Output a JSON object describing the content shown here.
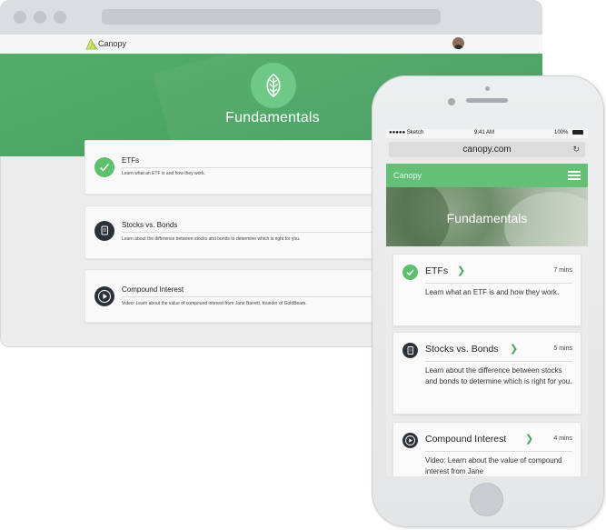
{
  "desktop": {
    "brand": "Canopy",
    "hero_title": "Fundamentals",
    "lessons": [
      {
        "title": "ETFs",
        "desc": "Learn what an ETF is and how they work.",
        "icon": "check-icon"
      },
      {
        "title": "Stocks vs. Bonds",
        "desc": "Learn about the difference between stocks and bonds to determine which is right for you.",
        "icon": "document-icon"
      },
      {
        "title": "Compound Interest",
        "desc": "Video: Learn about the value of compound interest from Jane Barrett, founder of GoldBeam.",
        "icon": "play-icon"
      }
    ]
  },
  "mobile": {
    "status": {
      "carrier": "●●●●● Sketch",
      "time": "9:41 AM",
      "battery": "100%"
    },
    "url": "canopy.com",
    "brand": "Canopy",
    "hero_title": "Fundamentals",
    "lessons": [
      {
        "title": "ETFs",
        "duration": "7 mins",
        "desc": "Learn what an ETF is and how they work.",
        "icon": "check-icon"
      },
      {
        "title": "Stocks vs. Bonds",
        "duration": "5 mins",
        "desc": "Learn about the difference between stocks and bonds to determine which is right for you.",
        "icon": "document-icon"
      },
      {
        "title": "Compound Interest",
        "duration": "4 mins",
        "desc": "Video: Learn about the value of compound interest from Jane",
        "icon": "play-icon"
      }
    ]
  },
  "colors": {
    "accent": "#4caa65",
    "mobile_bar": "#63c076",
    "dark_icon": "#2a3138"
  }
}
